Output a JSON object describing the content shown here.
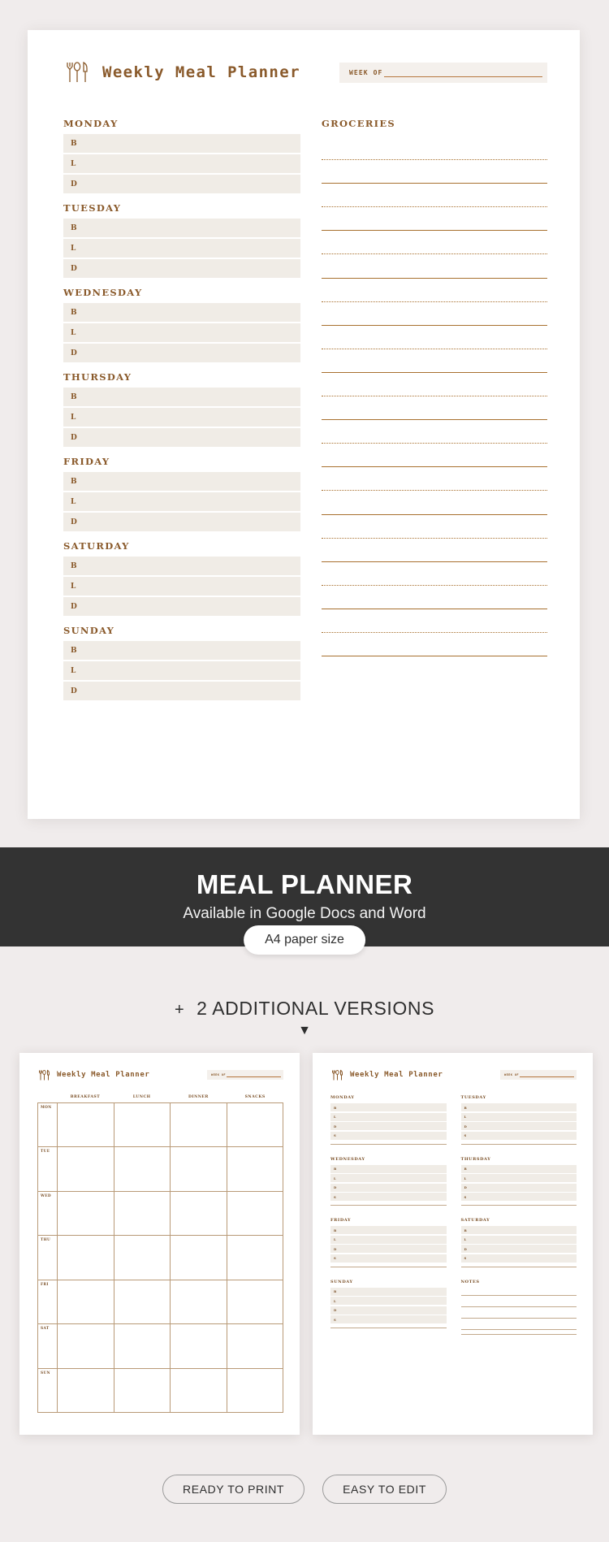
{
  "hero": {
    "title": "Weekly Meal Planner",
    "cutlery_icon": "fork-spoon-knife-icon",
    "week_of_label": "WEEK OF",
    "groceries_title": "GROCERIES",
    "days": [
      {
        "name": "MONDAY",
        "meals": [
          "B",
          "L",
          "D"
        ]
      },
      {
        "name": "TUESDAY",
        "meals": [
          "B",
          "L",
          "D"
        ]
      },
      {
        "name": "WEDNESDAY",
        "meals": [
          "B",
          "L",
          "D"
        ]
      },
      {
        "name": "THURSDAY",
        "meals": [
          "B",
          "L",
          "D"
        ]
      },
      {
        "name": "FRIDAY",
        "meals": [
          "B",
          "L",
          "D"
        ]
      },
      {
        "name": "SATURDAY",
        "meals": [
          "B",
          "L",
          "D"
        ]
      },
      {
        "name": "SUNDAY",
        "meals": [
          "B",
          "L",
          "D"
        ]
      }
    ],
    "grocery_line_count": 22
  },
  "banner": {
    "title": "MEAL PLANNER",
    "subtitle": "Available in Google Docs and Word",
    "paper_size_pill": "A4 paper size"
  },
  "additional": {
    "plus": "+",
    "text": "2 ADDITIONAL VERSIONS",
    "arrow_icon": "chevron-down-icon",
    "arrow_glyph": "▼"
  },
  "thumbnails": {
    "grid_version": {
      "title": "Weekly Meal Planner",
      "week_of_label": "WEEK OF",
      "columns": [
        "BREAKFAST",
        "LUNCH",
        "DINNER",
        "SNACKS"
      ],
      "days": [
        "MON",
        "TUE",
        "WED",
        "THU",
        "FRI",
        "SAT",
        "SUN"
      ]
    },
    "list_version": {
      "title": "Weekly Meal Planner",
      "week_of_label": "WEEK OF",
      "meals": [
        "B",
        "L",
        "D",
        "S"
      ],
      "blocks": [
        "MONDAY",
        "TUESDAY",
        "WEDNESDAY",
        "THURSDAY",
        "FRIDAY",
        "SATURDAY",
        "SUNDAY"
      ],
      "notes_title": "NOTES"
    }
  },
  "footer_buttons": [
    {
      "label": "READY TO PRINT"
    },
    {
      "label": "EASY TO EDIT"
    }
  ],
  "colors": {
    "page_bg": "#f0ecec",
    "sheet_bg": "#ffffff",
    "accent_brown": "#8a5a2b",
    "row_fill": "#f0ece6",
    "banner_bg": "#333333",
    "rule": "#a8702f"
  }
}
